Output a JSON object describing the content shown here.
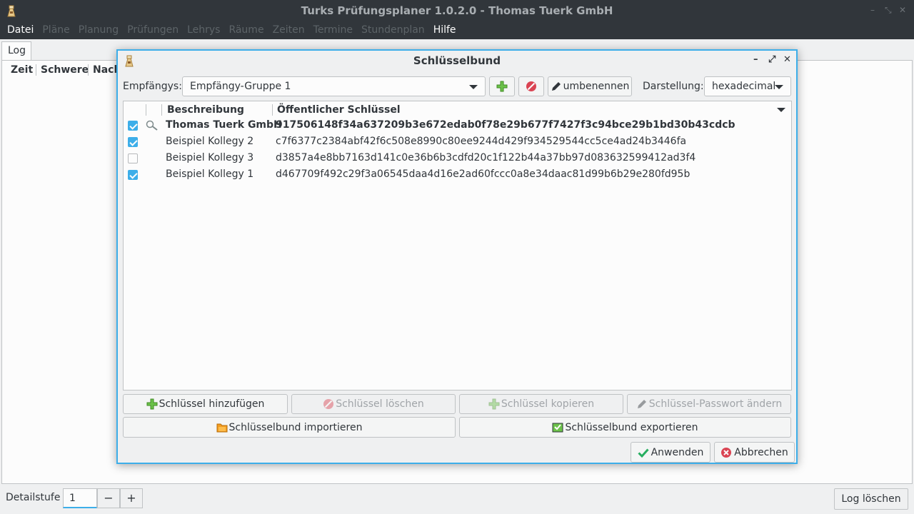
{
  "window": {
    "title": "Turks Prüfungsplaner 1.0.2.0 - Thomas Tuerk GmbH",
    "controls": [
      "–",
      "⤡",
      "✕"
    ]
  },
  "menu": [
    {
      "label": "Datei",
      "enabled": true
    },
    {
      "label": "Pläne",
      "enabled": false
    },
    {
      "label": "Planung",
      "enabled": false
    },
    {
      "label": "Prüfungen",
      "enabled": false
    },
    {
      "label": "Lehrys",
      "enabled": false
    },
    {
      "label": "Räume",
      "enabled": false
    },
    {
      "label": "Zeiten",
      "enabled": false
    },
    {
      "label": "Termine",
      "enabled": false
    },
    {
      "label": "Stundenplan",
      "enabled": false
    },
    {
      "label": "Hilfe",
      "enabled": true
    }
  ],
  "log": {
    "tab_label": "Log",
    "columns": [
      "Zeit",
      "Schwere",
      "Nach"
    ],
    "detail_label": "Detailstufe",
    "detail_value": "1",
    "minus": "−",
    "plus": "+",
    "clear_label": "Log löschen"
  },
  "dialog": {
    "title": "Schlüsselbund",
    "controls": [
      "–",
      "⤢",
      "✕"
    ],
    "recipients_label": "Empfängys:",
    "recipients_value": "Empfängy-Gruppe 1",
    "rename_label": "umbenennen",
    "display_label": "Darstellung:",
    "display_value": "hexadecimal",
    "columns": {
      "description": "Beschreibung",
      "public_key": "Öffentlicher Schlüssel"
    },
    "rows": [
      {
        "checked": true,
        "own_key": true,
        "description": "Thomas Tuerk GmbH",
        "key": "917506148f34a637209b3e672edab0f78e29b677f7427f3c94bce29b1bd30b43cdcb"
      },
      {
        "checked": true,
        "own_key": false,
        "description": "Beispiel Kollegy 2",
        "key": "c7f6377c2384abf42f6c508e8990c80ee9244d429f934529544cc5ce4ad24b3446fa"
      },
      {
        "checked": false,
        "own_key": false,
        "description": "Beispiel Kollegy 3",
        "key": "d3857a4e8bb7163d141c0e36b6b3cdfd20c1f122b44a37bb97d083632599412ad3f4"
      },
      {
        "checked": true,
        "own_key": false,
        "description": "Beispiel Kollegy 1",
        "key": "d467709f492c29f3a06545daa4d16e2ad60fccc0a8e34daac81d99b6b29e280fd95b"
      }
    ],
    "buttons": {
      "add_key": "Schlüssel hinzufügen",
      "delete_key": "Schlüssel löschen",
      "copy_key": "Schlüssel kopieren",
      "change_password": "Schlüssel-Passwort ändern",
      "import": "Schlüsselbund importieren",
      "export": "Schlüsselbund exportieren",
      "apply": "Anwenden",
      "cancel": "Abbrechen"
    }
  },
  "colors": {
    "accent": "#3daee9",
    "titlebar": "#31363b",
    "add_green": "#6cc24a",
    "stop_red": "#da4453"
  }
}
